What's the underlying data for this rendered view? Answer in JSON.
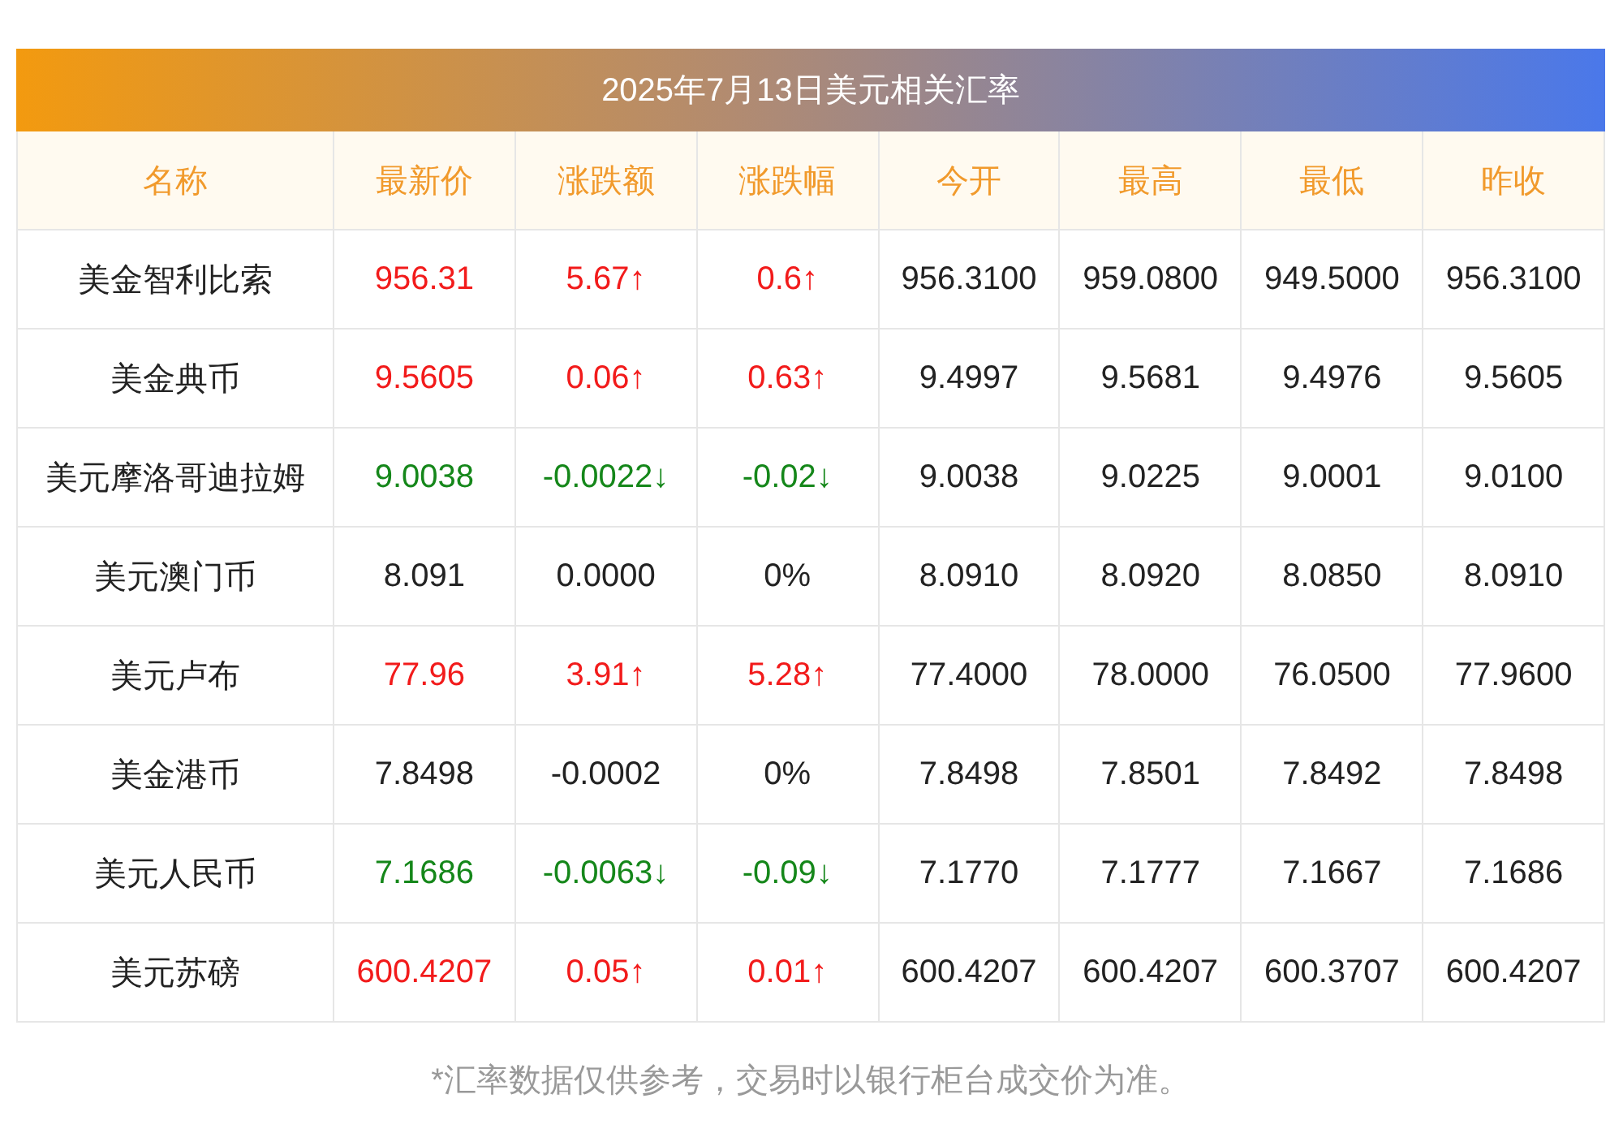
{
  "title": "2025年7月13日美元相关汇率",
  "columns": [
    "名称",
    "最新价",
    "涨跌额",
    "涨跌幅",
    "今开",
    "最高",
    "最低",
    "昨收"
  ],
  "rows": [
    {
      "color": "#f21b1b",
      "cells": [
        "美金智利比索",
        "956.31",
        "5.67↑",
        "0.6↑",
        "956.3100",
        "959.0800",
        "949.5000",
        "956.3100"
      ]
    },
    {
      "color": "#f21b1b",
      "cells": [
        "美金典币",
        "9.5605",
        "0.06↑",
        "0.63↑",
        "9.4997",
        "9.5681",
        "9.4976",
        "9.5605"
      ]
    },
    {
      "color": "#15871a",
      "cells": [
        "美元摩洛哥迪拉姆",
        "9.0038",
        "-0.0022↓",
        "-0.02↓",
        "9.0038",
        "9.0225",
        "9.0001",
        "9.0100"
      ]
    },
    {
      "color": "#222222",
      "cells": [
        "美元澳门币",
        "8.091",
        "0.0000",
        "0%",
        "8.0910",
        "8.0920",
        "8.0850",
        "8.0910"
      ]
    },
    {
      "color": "#f21b1b",
      "cells": [
        "美元卢布",
        "77.96",
        "3.91↑",
        "5.28↑",
        "77.4000",
        "78.0000",
        "76.0500",
        "77.9600"
      ]
    },
    {
      "color": "#222222",
      "cells": [
        "美金港币",
        "7.8498",
        "-0.0002",
        "0%",
        "7.8498",
        "7.8501",
        "7.8492",
        "7.8498"
      ]
    },
    {
      "color": "#15871a",
      "cells": [
        "美元人民币",
        "7.1686",
        "-0.0063↓",
        "-0.09↓",
        "7.1770",
        "7.1777",
        "7.1667",
        "7.1686"
      ]
    },
    {
      "color": "#f21b1b",
      "cells": [
        "美元苏磅",
        "600.4207",
        "0.05↑",
        "0.01↑",
        "600.4207",
        "600.4207",
        "600.3707",
        "600.4207"
      ]
    }
  ],
  "footnote": "*汇率数据仅供参考，交易时以银行柜台成交价为准。"
}
